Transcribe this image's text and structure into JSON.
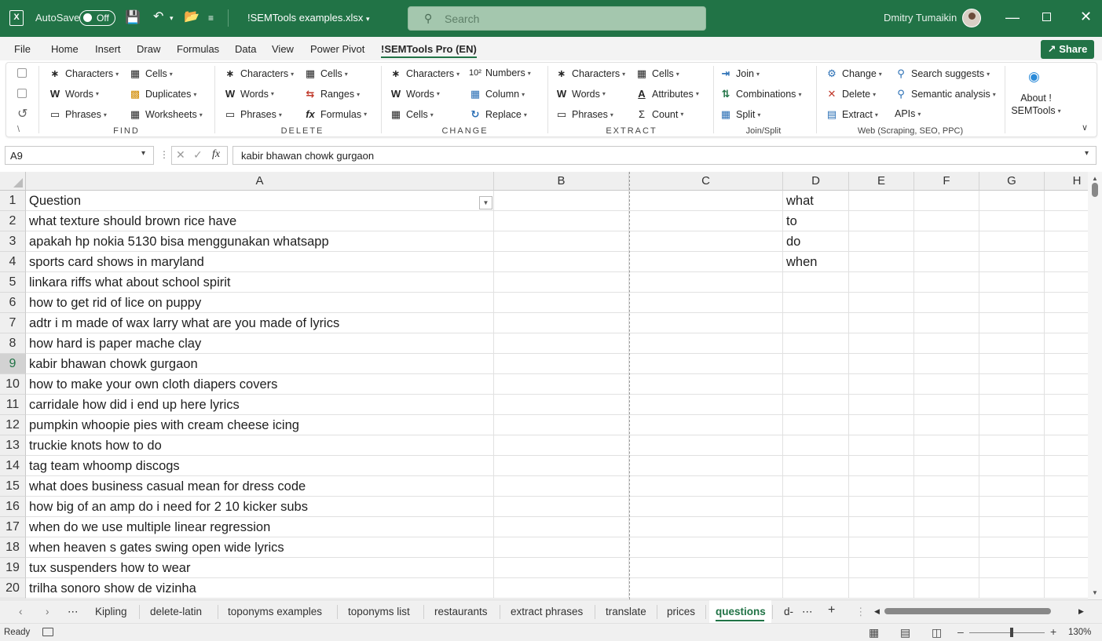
{
  "titlebar": {
    "autosave_label": "AutoSave",
    "autosave_state": "Off",
    "filename": "!SEMTools examples.xlsx",
    "search_placeholder": "Search",
    "username": "Dmitry Tumaikin",
    "brand_color": "#217346"
  },
  "menu": {
    "tabs": [
      "File",
      "Home",
      "Insert",
      "Draw",
      "Formulas",
      "Data",
      "View",
      "Power Pivot",
      "!SEMTools Pro (EN)"
    ],
    "active_tab": "!SEMTools Pro (EN)",
    "share_label": "Share"
  },
  "ribbon": {
    "quick_access": {
      "small_label": "\\"
    },
    "find": {
      "label": "FIND",
      "items": [
        "Characters",
        "Words",
        "Phrases",
        "Cells",
        "Duplicates",
        "Worksheets"
      ]
    },
    "delete": {
      "label": "DELETE",
      "items": [
        "Characters",
        "Words",
        "Phrases",
        "Cells",
        "Ranges",
        "Formulas"
      ]
    },
    "change": {
      "label": "CHANGE",
      "items": [
        "Characters",
        "Words",
        "Cells",
        "Numbers",
        "Column",
        "Replace"
      ]
    },
    "extract": {
      "label": "EXTRACT",
      "items": [
        "Characters",
        "Words",
        "Phrases",
        "Cells",
        "Attributes",
        "Count"
      ]
    },
    "joinsplit": {
      "label": "Join/Split",
      "items": [
        "Join",
        "Combinations",
        "Split"
      ]
    },
    "web": {
      "label": "Web (Scraping, SEO, PPC)",
      "items": [
        "Change",
        "Delete",
        "Extract",
        "Search suggests",
        "Semantic analysis",
        "APIs"
      ]
    },
    "about": {
      "line1": "About !",
      "line2": "SEMTools"
    }
  },
  "formula_bar": {
    "name_box": "A9",
    "fx": "fx",
    "content": "kabir bhawan chowk gurgaon"
  },
  "grid": {
    "columns": [
      "A",
      "B",
      "C",
      "D",
      "E",
      "F",
      "G",
      "H"
    ],
    "row_numbers": [
      "1",
      "2",
      "3",
      "4",
      "5",
      "6",
      "7",
      "8",
      "9",
      "10",
      "11",
      "12",
      "13",
      "14",
      "15",
      "16",
      "17",
      "18",
      "19",
      "20"
    ],
    "selected_row": "9",
    "col_a": [
      "Question",
      "what texture should brown rice have",
      "apakah hp nokia 5130 bisa menggunakan whatsapp",
      "sports card shows in maryland",
      "linkara riffs what about school spirit",
      "how to get rid of lice on puppy",
      "adtr i m made of wax larry what are you made of lyrics",
      "how hard is paper mache clay",
      "kabir bhawan chowk gurgaon",
      "how to make your own cloth diapers covers",
      "carridale how did i end up here lyrics",
      "pumpkin whoopie pies with cream cheese icing",
      "truckie knots how to do",
      "tag team whoomp discogs",
      "what does business casual mean for dress code",
      "how big of an amp do i need for 2 10 kicker subs",
      "when do we use multiple linear regression",
      "when heaven s gates swing open wide lyrics",
      "tux suspenders how to wear",
      "trilha sonoro show de vizinha"
    ],
    "col_d": [
      "what",
      "to",
      "do",
      "when"
    ]
  },
  "sheets": {
    "tabs": [
      "Kipling",
      "delete-latin",
      "toponyms examples",
      "toponyms list",
      "restaurants",
      "extract phrases",
      "translate",
      "prices",
      "questions",
      "d-"
    ],
    "active": "questions"
  },
  "status": {
    "ready": "Ready",
    "zoom": "130%"
  }
}
